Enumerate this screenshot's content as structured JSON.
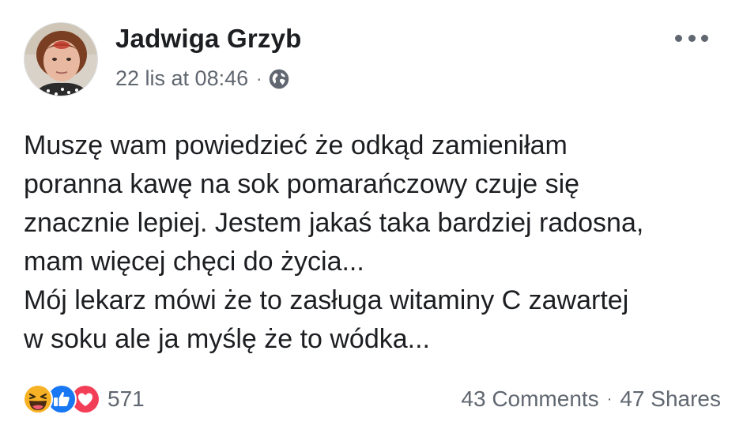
{
  "post": {
    "author": "Jadwiga Grzyb",
    "timestamp": "22 lis at 08:46",
    "separator": "·",
    "privacy_icon": "globe-icon",
    "menu_icon": "more-options-icon",
    "body_lines": [
      "Muszę wam powiedzieć że odkąd zamieniłam",
      "poranna kawę na sok pomarańczowy czuje się",
      "znacznie lepiej. Jestem jakaś taka bardziej radosna,",
      "mam więcej chęci do życia...",
      "Mój lekarz mówi że to zasługa witaminy C zawartej",
      "w soku ale ja myślę że to wódka..."
    ]
  },
  "footer": {
    "reaction_icons": [
      "haha-reaction-icon",
      "like-reaction-icon",
      "love-reaction-icon"
    ],
    "reaction_count": "571",
    "comments": "43 Comments",
    "separator": "·",
    "shares": "47 Shares"
  },
  "colors": {
    "text_primary": "#1c1e21",
    "text_secondary": "#606770",
    "like_blue": "#1877f2",
    "love_red": "#f33e58",
    "haha_yellow": "#f7b125"
  }
}
